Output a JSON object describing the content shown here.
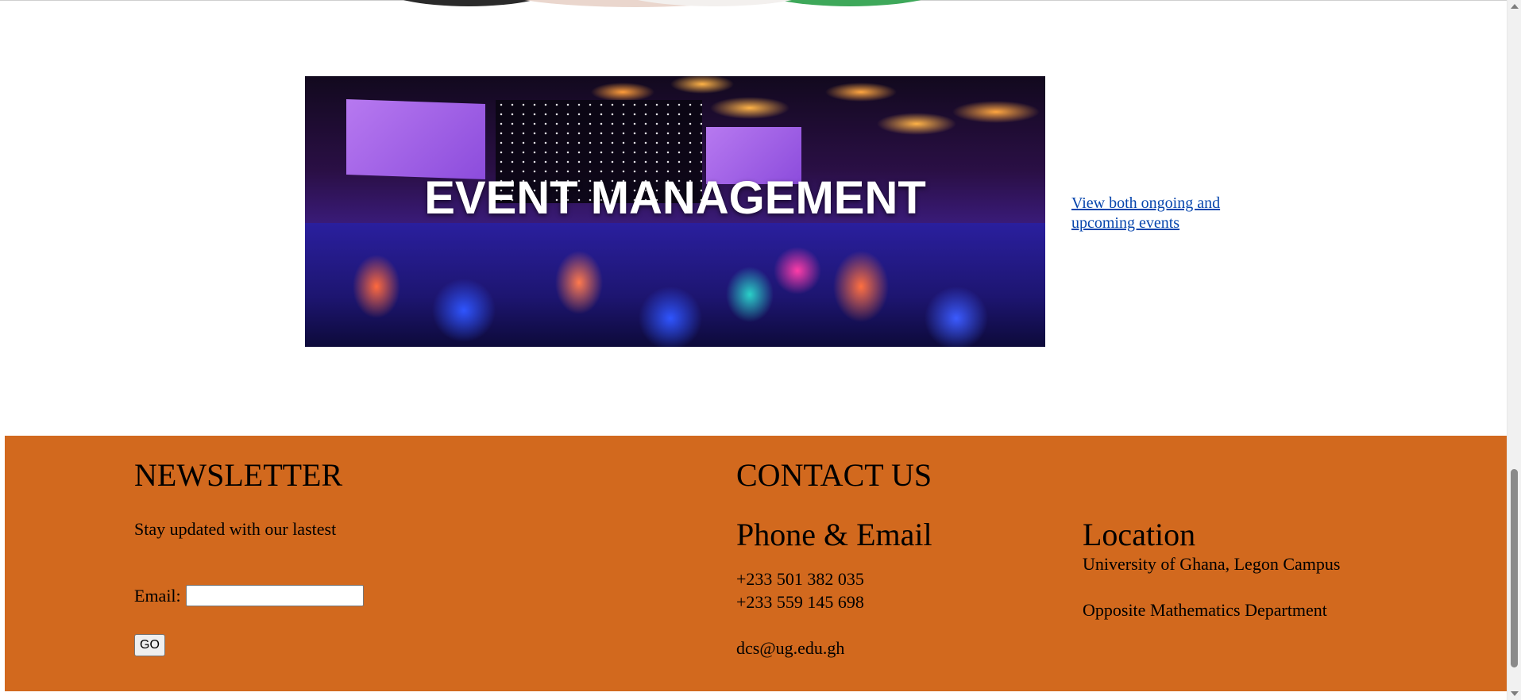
{
  "events": {
    "banner_title": "EVENT MANAGEMENT",
    "link_text": "View both ongoing and upcoming events"
  },
  "newsletter": {
    "heading": "NEWSLETTER",
    "subtext": "Stay updated with our lastest",
    "email_label": "Email:",
    "email_value": "",
    "button_label": "GO"
  },
  "contact": {
    "heading": "CONTACT US",
    "phone_email_heading": "Phone & Email",
    "phone_1": "+233 501 382 035",
    "phone_2": "+233 559 145 698",
    "email": "dcs@ug.edu.gh"
  },
  "location": {
    "heading": "Location",
    "line_1": "University of Ghana, Legon Campus",
    "line_2": "Opposite Mathematics Department"
  },
  "colors": {
    "footer_background": "#d2691e",
    "link": "#0645ad"
  },
  "scrollbar": {
    "scroll_position": 0.95
  }
}
